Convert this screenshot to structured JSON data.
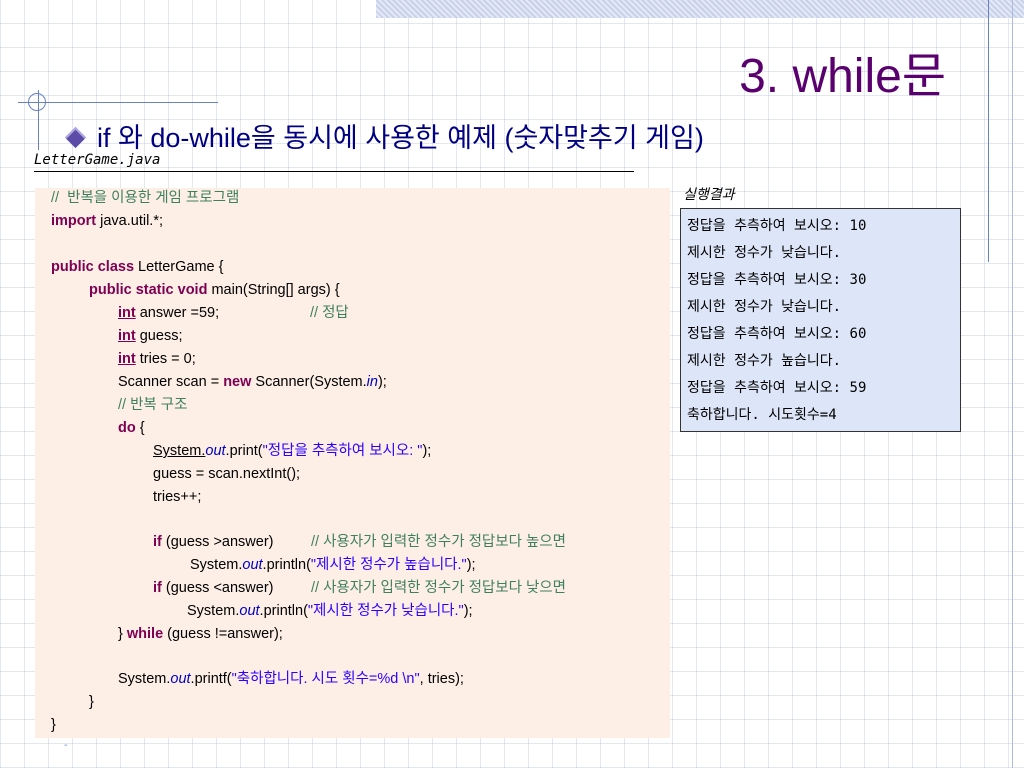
{
  "slide": {
    "title": "3. while문",
    "bullet": "if 와 do-while을 동시에 사용한 예제 (숫자맞추기 게임)",
    "filename": "LetterGame.java",
    "result_label": "실행결과",
    "footer_mark": "-"
  },
  "code": {
    "l1": "//  반복을 이용한 게임 프로그램",
    "l2_kw": "import",
    "l2_rest": " java.util.*;",
    "l3_kw": "public class",
    "l3_rest": " LetterGame {",
    "l4_kw": "public static void",
    "l4_rest": " main(String[] args) {",
    "l5_kw": "int",
    "l5_rest": " answer =59;",
    "l5_cm": "// 정답",
    "l6_kw": "int",
    "l6_rest": " guess;",
    "l7_kw": "int",
    "l7_rest": " tries = 0;",
    "l8_a": "Scanner scan = ",
    "l8_kw": "new",
    "l8_b": " Scanner(System.",
    "l8_it": "in",
    "l8_c": ");",
    "l9": "// 반복 구조",
    "l10_kw": "do",
    "l10_rest": " {",
    "l11_a": "System.",
    "l11_it": "out",
    "l11_b": ".print(",
    "l11_st": "\"정답을 추측하여 보시오: \"",
    "l11_c": ");",
    "l12": "guess = scan.nextInt();",
    "l13": "tries++;",
    "l14_kw": "if",
    "l14_rest": " (guess >answer)",
    "l14_cm": "// 사용자가 입력한 정수가 정답보다 높으면",
    "l15_a": "System.",
    "l15_it": "out",
    "l15_b": ".println(",
    "l15_st": "\"제시한 정수가 높습니다.\"",
    "l15_c": ");",
    "l16_kw": "if",
    "l16_rest": " (guess <answer)",
    "l16_cm": "// 사용자가 입력한 정수가 정답보다 낮으면",
    "l17_a": "System.",
    "l17_it": "out",
    "l17_b": ".println(",
    "l17_st": "\"제시한 정수가 낮습니다.\"",
    "l17_c": ");",
    "l18_a": "} ",
    "l18_kw": "while",
    "l18_rest": " (guess !=answer);",
    "l19_a": "System.",
    "l19_it": "out",
    "l19_b": ".printf(",
    "l19_st": "\"축하합니다. 시도 횟수=%d \\n\"",
    "l19_c": ", tries);",
    "l20": "}",
    "l21": "}"
  },
  "result": {
    "lines": [
      "정답을 추측하여 보시오: 10",
      "제시한 정수가 낮습니다.",
      "정답을 추측하여 보시오: 30",
      "제시한 정수가 낮습니다.",
      "정답을 추측하여 보시오: 60",
      "제시한 정수가 높습니다.",
      "정답을 추측하여 보시오: 59",
      "축하합니다. 시도횟수=4"
    ]
  }
}
